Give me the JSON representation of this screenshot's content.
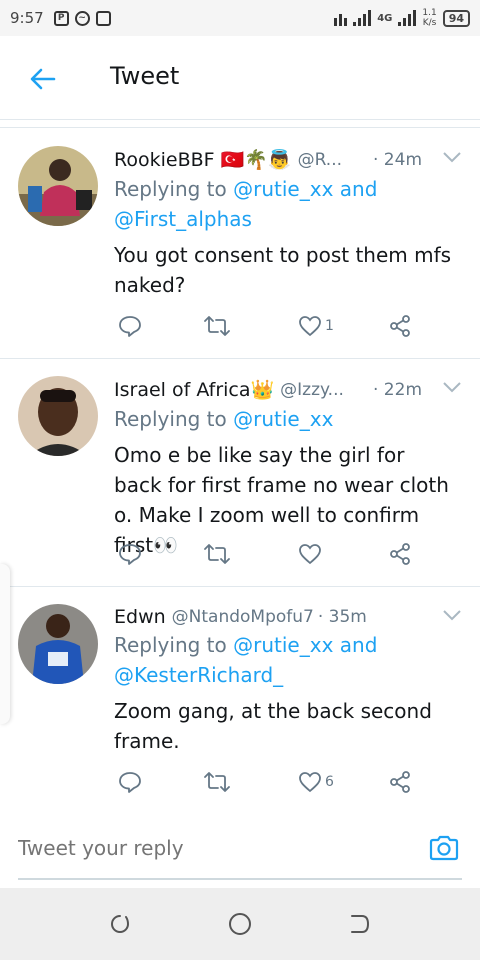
{
  "status_bar": {
    "time": "9:57",
    "network": "4G",
    "speed_value": "1.1",
    "speed_unit": "K/s",
    "battery": "94"
  },
  "header": {
    "title": "Tweet"
  },
  "colors": {
    "accent": "#1da1f2",
    "text": "#14171a",
    "muted": "#657786"
  },
  "tweets": [
    {
      "name": "RookieBBF 🇹🇷🌴👼",
      "handle": "@R...",
      "time": "· 24m",
      "replying_prefix": "Replying to",
      "mention1": "@rutie_xx",
      "and": "and",
      "mention2": "@First_alphas",
      "text": "You got consent to post them mfs naked?",
      "likes": "1"
    },
    {
      "name": "Israel of Africa👑",
      "handle": "@Izzy...",
      "time": "· 22m",
      "replying_prefix": "Replying to",
      "mention1": "@rutie_xx",
      "text": "Omo e be like say the girl for back for first frame no wear cloth o. Make I zoom well to confirm first👀",
      "likes": ""
    },
    {
      "name": "Edwn",
      "handle": "@NtandoMpofu7",
      "time": "· 35m",
      "replying_prefix": "Replying to",
      "mention1": "@rutie_xx",
      "and": "and",
      "mention2": "@KesterRichard_",
      "text": "Zoom gang, at the back second frame.",
      "likes": "6"
    }
  ],
  "reply": {
    "placeholder": "Tweet your reply"
  },
  "icons": {
    "back": "arrow-left-icon",
    "reply": "comment-icon",
    "retweet": "retweet-icon",
    "like": "heart-icon",
    "share": "share-icon",
    "camera": "camera-icon"
  }
}
